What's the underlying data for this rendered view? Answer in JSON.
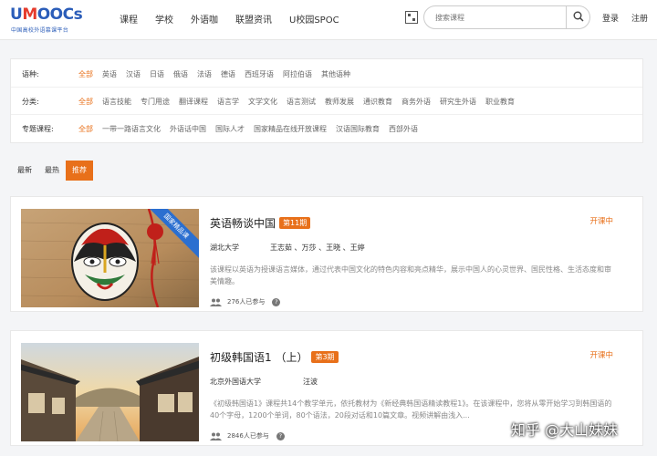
{
  "logo": {
    "title": "UMOOCs",
    "subtitle": "中国高校外语慕课平台"
  },
  "nav": [
    "课程",
    "学校",
    "外语咖",
    "联盟资讯",
    "U校园SPOC"
  ],
  "search": {
    "placeholder": "搜索课程"
  },
  "auth": {
    "login": "登录",
    "register": "注册"
  },
  "filters": {
    "language": {
      "label": "语种:",
      "options": [
        "全部",
        "英语",
        "汉语",
        "日语",
        "俄语",
        "法语",
        "德语",
        "西班牙语",
        "阿拉伯语",
        "其他语种"
      ]
    },
    "category": {
      "label": "分类:",
      "options": [
        "全部",
        "语言技能",
        "专门用途",
        "翻译课程",
        "语言学",
        "文学文化",
        "语言测试",
        "教师发展",
        "通识教育",
        "商务外语",
        "研究生外语",
        "职业教育"
      ]
    },
    "special": {
      "label": "专题课程:",
      "options": [
        "全部",
        "一带一路语言文化",
        "外语话中国",
        "国际人才",
        "国家精品在线开放课程",
        "汉语国际教育",
        "西部外语"
      ]
    }
  },
  "sort_tabs": [
    "最新",
    "最热",
    "推荐"
  ],
  "courses": [
    {
      "title": "英语畅谈中国",
      "term": "第11期",
      "status": "开课中",
      "school": "湖北大学",
      "teachers": "王志茹 、万莎 、王晓 、王婷",
      "description": "该课程以英语为授课语言媒体，通过代表中国文化的特色内容和亮点精华，展示中国人的心灵世界、国民性格、生活态度和审美情趣。",
      "participants": "276人已参与",
      "badge": "国家精品课"
    },
    {
      "title": "初级韩国语1 （上）",
      "term": "第3期",
      "status": "开课中",
      "school": "北京外国语大学",
      "teachers": "汪波",
      "description": "《初级韩国语1》课程共14个教学单元，依托教材为《新经典韩国语精读教程1》。在该课程中，您将从零开始学习到韩国语的40个字母，1200个单词，80个语法，20段对话和10篇文章。视频讲解由浅入...",
      "participants": "2846人已参与"
    }
  ],
  "watermark": "知乎 @大山妹妹",
  "colors": {
    "accent": "#e8701a",
    "brand": "#2b5db9",
    "badge": "#2b6fd0"
  }
}
